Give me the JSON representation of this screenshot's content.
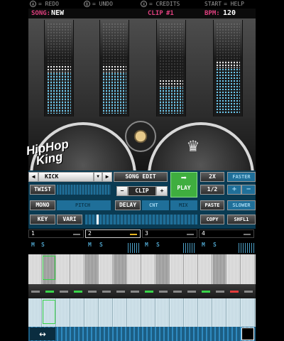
{
  "helpbar": {
    "items": [
      {
        "button": "A",
        "action": "= REDO"
      },
      {
        "button": "B",
        "action": "= UNDO"
      },
      {
        "button": "X",
        "action": "= CREDITS"
      },
      {
        "button": "START",
        "action": "= HELP"
      }
    ]
  },
  "status": {
    "song_label": "SONG:",
    "song_value": "NEW",
    "clip_label": "CLIP",
    "clip_value": "#1",
    "bpm_label": "BPM:",
    "bpm_value": "120"
  },
  "meters": [
    {
      "name": "meter-1",
      "level": 0.45
    },
    {
      "name": "meter-2",
      "level": 0.45
    },
    {
      "name": "meter-3",
      "level": 0.3
    },
    {
      "name": "meter-4",
      "level": 0.5
    }
  ],
  "logo": {
    "line1": "HipHop",
    "line2": "King"
  },
  "controls": {
    "instrument": "KICK",
    "song_edit": "SONG EDIT",
    "clip": "CLIP",
    "minus": "−",
    "plus": "+",
    "play": "PLAY",
    "twox": "2X",
    "half": "1/2",
    "faster": "FASTER",
    "slower": "SLOWER",
    "twist": "TWIST",
    "mono": "MONO",
    "pitch": "PITCH",
    "delay": "DELAY",
    "cnt": "CNT",
    "mix": "MIX",
    "paste": "PASTE",
    "key": "KEY",
    "vari": "VARI",
    "copy": "COPY",
    "shfl": "SHFL1",
    "twist_sub": "TWIST"
  },
  "tracks": [
    {
      "label": "1",
      "selected": false
    },
    {
      "label": "2",
      "selected": true
    },
    {
      "label": "3",
      "selected": false
    },
    {
      "label": "4",
      "selected": false
    }
  ],
  "msrow": {
    "m": "M",
    "s": "S"
  },
  "sequencer": {
    "steps_on": [
      1,
      4,
      6,
      9,
      13
    ],
    "leds": [
      "off",
      "g",
      "off",
      "g",
      "off",
      "off",
      "off",
      "off",
      "g",
      "off",
      "off",
      "off",
      "g",
      "off",
      "r",
      "off"
    ]
  },
  "scroll": {
    "arrow": "↔"
  }
}
